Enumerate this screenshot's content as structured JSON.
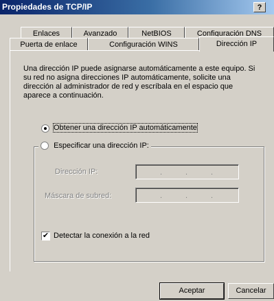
{
  "window": {
    "title": "Propiedades de TCP/IP",
    "help_label": "?"
  },
  "tabs_row1": [
    {
      "label": "Enlaces"
    },
    {
      "label": "Avanzado"
    },
    {
      "label": "NetBIOS"
    },
    {
      "label": "Configuración DNS"
    }
  ],
  "tabs_row2": [
    {
      "label": "Puerta de enlace"
    },
    {
      "label": "Configuración WINS"
    },
    {
      "label": "Dirección IP",
      "active": true
    }
  ],
  "description": "Una dirección IP puede asignarse automáticamente a este equipo. Si su red no asigna direcciones IP automáticamente, solicite una dirección al administrador de red y escríbala en el espacio que aparece a continuación.",
  "radio_auto": {
    "label": "Obtener una dirección IP automáticamente",
    "selected": true
  },
  "radio_manual": {
    "label": "Especificar una dirección IP:",
    "selected": false
  },
  "ip_address": {
    "label": "Dirección IP:",
    "dots": "."
  },
  "subnet_mask": {
    "label": "Máscara de subred:",
    "dots": "."
  },
  "detect": {
    "label": "Detectar la conexión a la red",
    "checked": true,
    "check_mark": "✔"
  },
  "buttons": {
    "ok": "Aceptar",
    "cancel": "Cancelar"
  }
}
